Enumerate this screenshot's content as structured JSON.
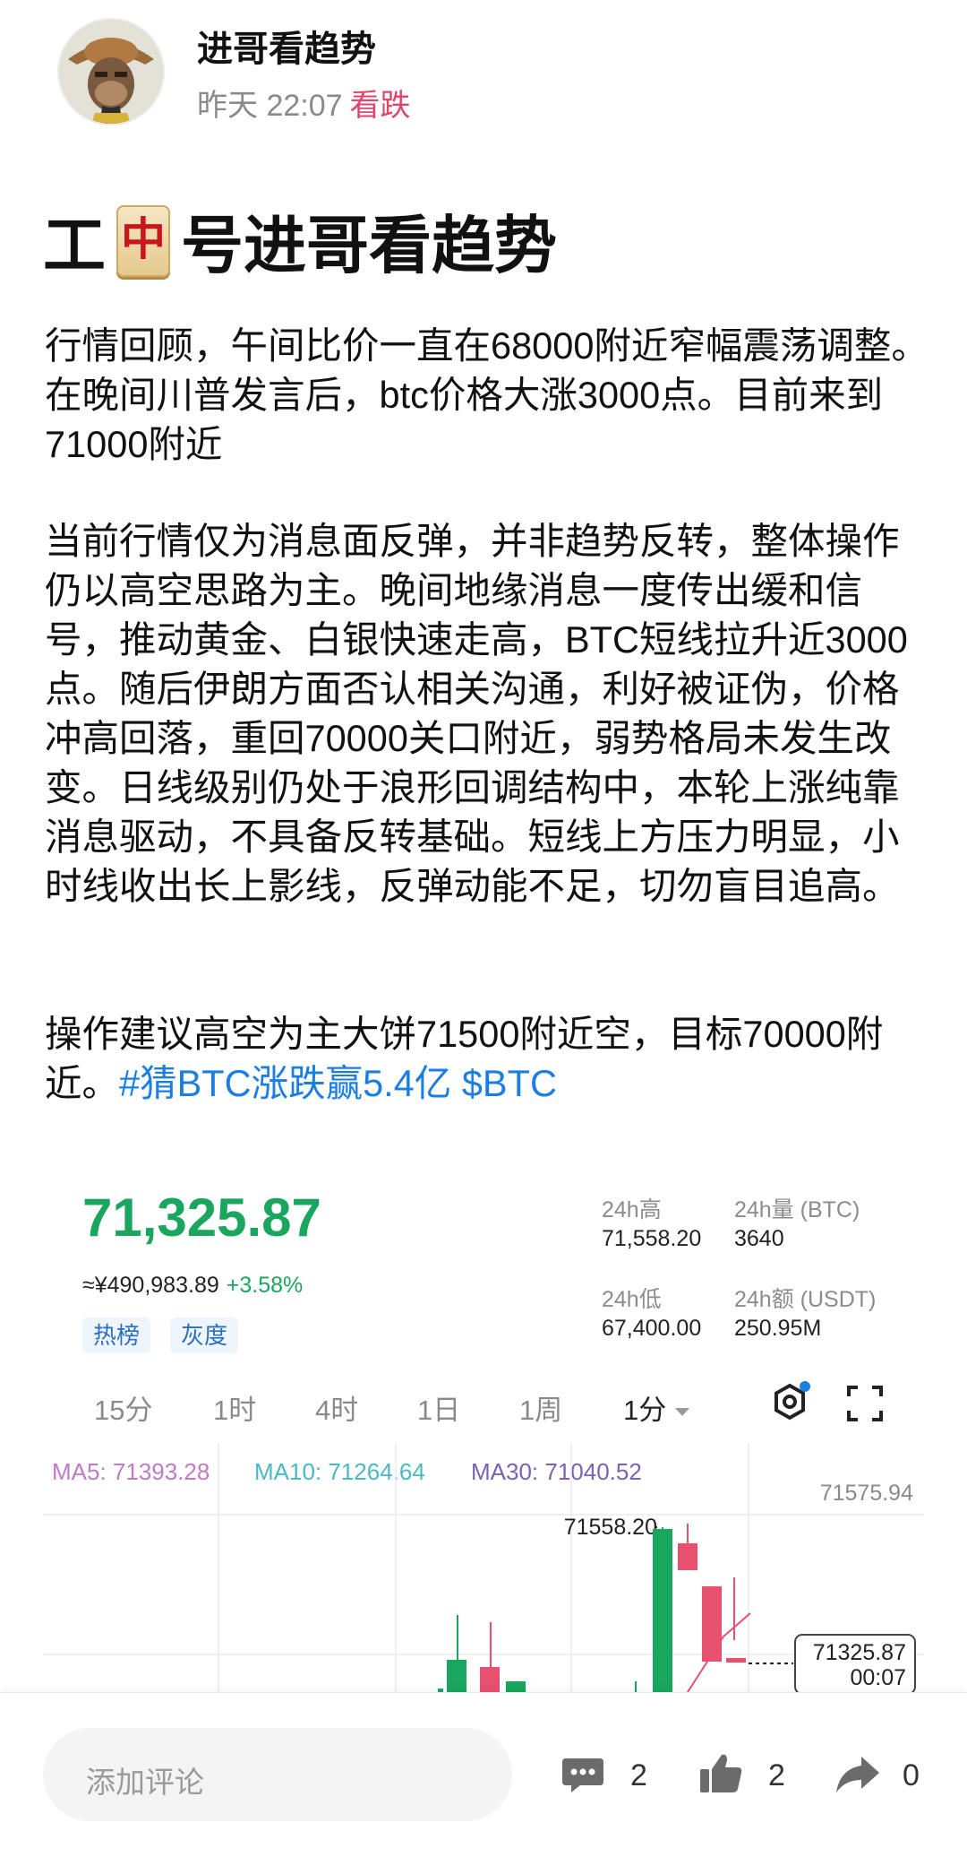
{
  "post": {
    "author": "进哥看趋势",
    "time": "昨天 22:07",
    "sentiment": "看跌",
    "title_before": "工",
    "title_tile_char": "中",
    "title_after": "号进哥看趋势",
    "paragraphs": [
      "行情回顾，午间比价一直在68000附近窄幅震荡调整。在晚间川普发言后，btc价格大涨3000点。目前来到71000附近",
      "当前行情仅为消息面反弹，并非趋势反转，整体操作仍以高空思路为主。晚间地缘消息一度传出缓和信号，推动黄金、白银快速走高，BTC短线拉升近3000点。随后伊朗方面否认相关沟通，利好被证伪，价格冲高回落，重回70000关口附近，弱势格局未发生改变。日线级别仍处于浪形回调结构中，本轮上涨纯靠消息驱动，不具备反转基础。短线上方压力明显，小时线收出长上影线，反弹动能不足，切勿盲目追高。",
      "操作建议高空为主大饼71500附近空，目标70000附近。"
    ],
    "topic_link": "#猜BTC涨跌赢5.4亿",
    "cashtag_link": "$BTC"
  },
  "market": {
    "price": "71,325.87",
    "cny": "≈¥490,983.89",
    "change": "+3.58%",
    "chips": [
      "热榜",
      "灰度"
    ],
    "stats": {
      "high_label": "24h高",
      "high": "71,558.20",
      "vol_label": "24h量 (BTC)",
      "vol": "3640",
      "low_label": "24h低",
      "low": "67,400.00",
      "amount_label": "24h额 (USDT)",
      "amount": "250.95M"
    },
    "timeframes": [
      "15分",
      "1时",
      "4时",
      "1日",
      "1周"
    ],
    "selected_timeframe": "1分",
    "ma": {
      "ma5": "MA5: 71393.28",
      "ma10": "MA10: 71264.64",
      "ma30": "MA30: 71040.52"
    },
    "chart_labels": {
      "axis_top": "71575.94",
      "high_mark": "71558.20",
      "current_price": "71325.87",
      "countdown": "00:07"
    },
    "colors": {
      "up": "#1aa65e",
      "down": "#e8506f",
      "ma5": "#c07ac7",
      "ma10": "#4bb8c9",
      "ma30": "#7a62b5"
    }
  },
  "bottom": {
    "comment_placeholder": "添加评论",
    "comments": "2",
    "likes": "2",
    "shares": "0"
  }
}
